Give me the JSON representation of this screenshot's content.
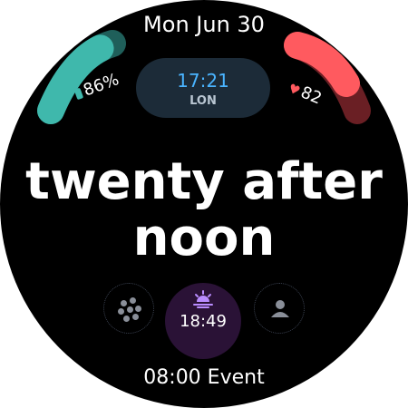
{
  "date": "Mon Jun 30",
  "world_clock": {
    "time": "17:21",
    "city": "LON"
  },
  "battery": {
    "label": "86%",
    "level": 0.86,
    "color": "#3fb8ac"
  },
  "heart_rate": {
    "label": "82",
    "color": "#ff5a5f"
  },
  "time_words": {
    "line1": "twenty after",
    "line2": "noon"
  },
  "complications": {
    "apps": {
      "icon": "apps-icon"
    },
    "sunset": {
      "time": "18:49",
      "icon": "sunset-icon"
    },
    "contact": {
      "icon": "contact-icon"
    }
  },
  "event": "08:00 Event",
  "colors": {
    "background": "#000000",
    "accent_blue": "#4ab4ff",
    "world_clock_bg": "#1c2b38",
    "sunset_bg": "#2a1236",
    "sunset_icon": "#b98cff"
  }
}
